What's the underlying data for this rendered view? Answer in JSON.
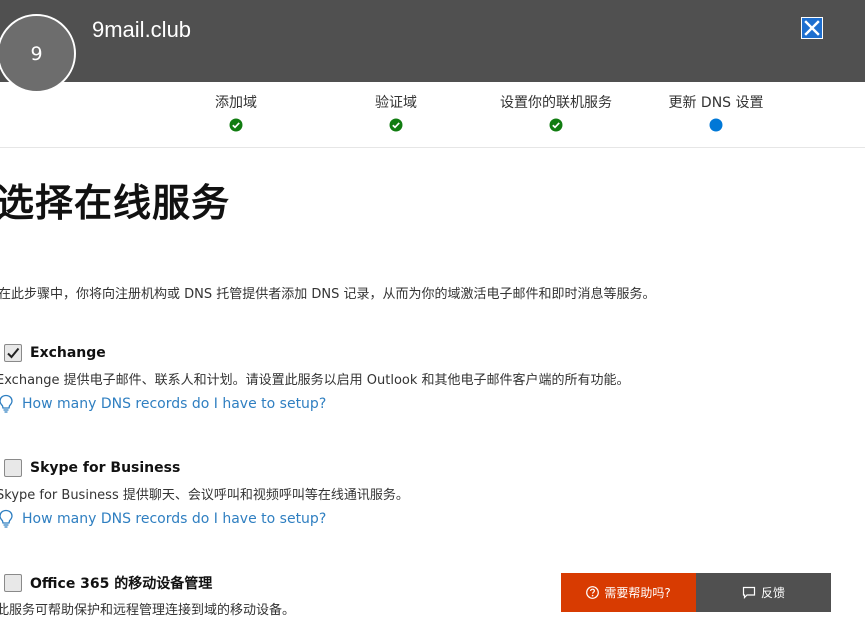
{
  "header": {
    "avatar_initial": "9",
    "domain": "9mail.club",
    "close_icon": "close-icon"
  },
  "steps": [
    {
      "label": "添加域",
      "status": "complete"
    },
    {
      "label": "验证域",
      "status": "complete"
    },
    {
      "label": "设置你的联机服务",
      "status": "complete"
    },
    {
      "label": "更新 DNS 设置",
      "status": "current"
    }
  ],
  "colors": {
    "header_bg": "#505050",
    "complete": "#107c10",
    "current": "#0078d7",
    "link": "#2f7fc1",
    "help_button": "#d83b01",
    "feedback_button": "#505050"
  },
  "main": {
    "title": "选择在线服务",
    "intro": "在此步骤中，你将向注册机构或 DNS 托管提供者添加 DNS 记录，从而为你的域激活电子邮件和即时消息等服务。"
  },
  "services": [
    {
      "name": "Exchange",
      "checked": true,
      "description": "Exchange 提供电子邮件、联系人和计划。请设置此服务以启用 Outlook 和其他电子邮件客户端的所有功能。",
      "help_link": "How many DNS records do I have to setup?"
    },
    {
      "name": "Skype for Business",
      "checked": false,
      "description": "Skype for Business 提供聊天、会议呼叫和视频呼叫等在线通讯服务。",
      "help_link": "How many DNS records do I have to setup?"
    },
    {
      "name": "Office 365 的移动设备管理",
      "checked": false,
      "description": "此服务可帮助保护和远程管理连接到域的移动设备。"
    }
  ],
  "footer": {
    "need_help": "需要帮助吗?",
    "feedback": "反馈"
  }
}
